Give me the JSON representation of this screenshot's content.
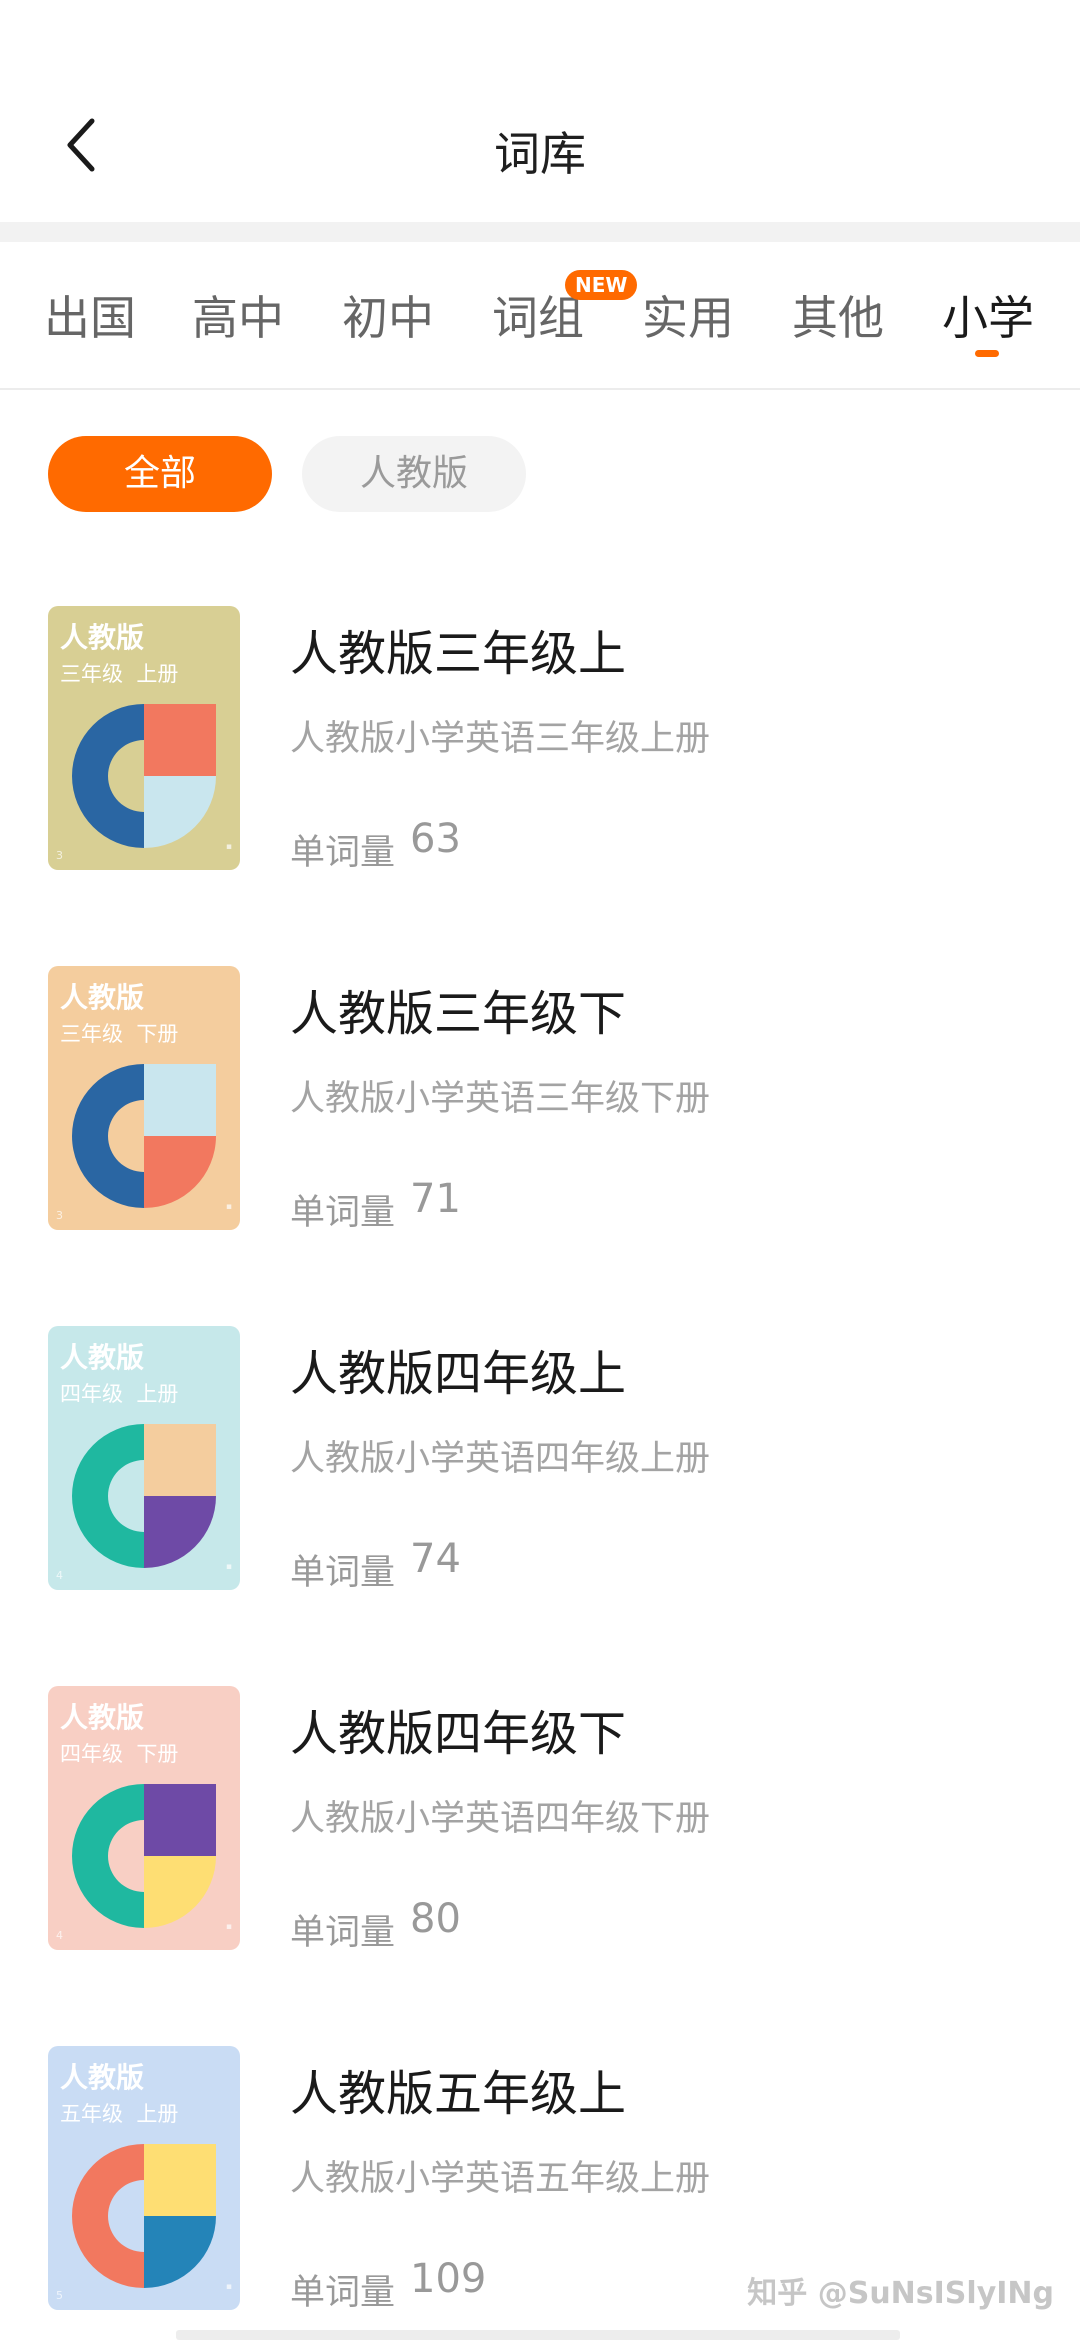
{
  "header": {
    "title": "词库",
    "back_icon": "chevron-left-icon"
  },
  "tabs": [
    {
      "label": "出国",
      "active": false
    },
    {
      "label": "高中",
      "active": false
    },
    {
      "label": "初中",
      "active": false
    },
    {
      "label": "词组",
      "active": false,
      "badge": "NEW"
    },
    {
      "label": "实用",
      "active": false
    },
    {
      "label": "其他",
      "active": false
    },
    {
      "label": "小学",
      "active": true
    }
  ],
  "filters": [
    {
      "label": "全部",
      "active": true
    },
    {
      "label": "人教版",
      "active": false
    }
  ],
  "colors": {
    "accent": "#ff6a00"
  },
  "books": [
    {
      "title": "人教版三年级上",
      "subtitle": "人教版小学英语三年级上册",
      "count_label": "单词量",
      "count": "63",
      "cover": {
        "publisher": "人教版",
        "grade": "三年级  上册",
        "bg": "#d8cf94",
        "ring": "#2a66a3",
        "top": "#f2785f",
        "bottom": "#c9e6ee",
        "no": "3"
      }
    },
    {
      "title": "人教版三年级下",
      "subtitle": "人教版小学英语三年级下册",
      "count_label": "单词量",
      "count": "71",
      "cover": {
        "publisher": "人教版",
        "grade": "三年级  下册",
        "bg": "#f4cd9e",
        "ring": "#2a66a3",
        "top": "#c9e6ee",
        "bottom": "#f2785f",
        "no": "3"
      }
    },
    {
      "title": "人教版四年级上",
      "subtitle": "人教版小学英语四年级上册",
      "count_label": "单词量",
      "count": "74",
      "cover": {
        "publisher": "人教版",
        "grade": "四年级  上册",
        "bg": "#c6e8ea",
        "ring": "#1fb8a0",
        "top": "#f4cd9e",
        "bottom": "#6e4aa6",
        "no": "4"
      }
    },
    {
      "title": "人教版四年级下",
      "subtitle": "人教版小学英语四年级下册",
      "count_label": "单词量",
      "count": "80",
      "cover": {
        "publisher": "人教版",
        "grade": "四年级  下册",
        "bg": "#f8cfc4",
        "ring": "#1fb8a0",
        "top": "#6e4aa6",
        "bottom": "#fede73",
        "no": "4"
      }
    },
    {
      "title": "人教版五年级上",
      "subtitle": "人教版小学英语五年级上册",
      "count_label": "单词量",
      "count": "109",
      "cover": {
        "publisher": "人教版",
        "grade": "五年级  上册",
        "bg": "#c9dcf4",
        "ring": "#f2785f",
        "top": "#fede73",
        "bottom": "#2484b8",
        "no": "5"
      }
    }
  ],
  "watermark": "知乎 @SuNsISlyINg"
}
